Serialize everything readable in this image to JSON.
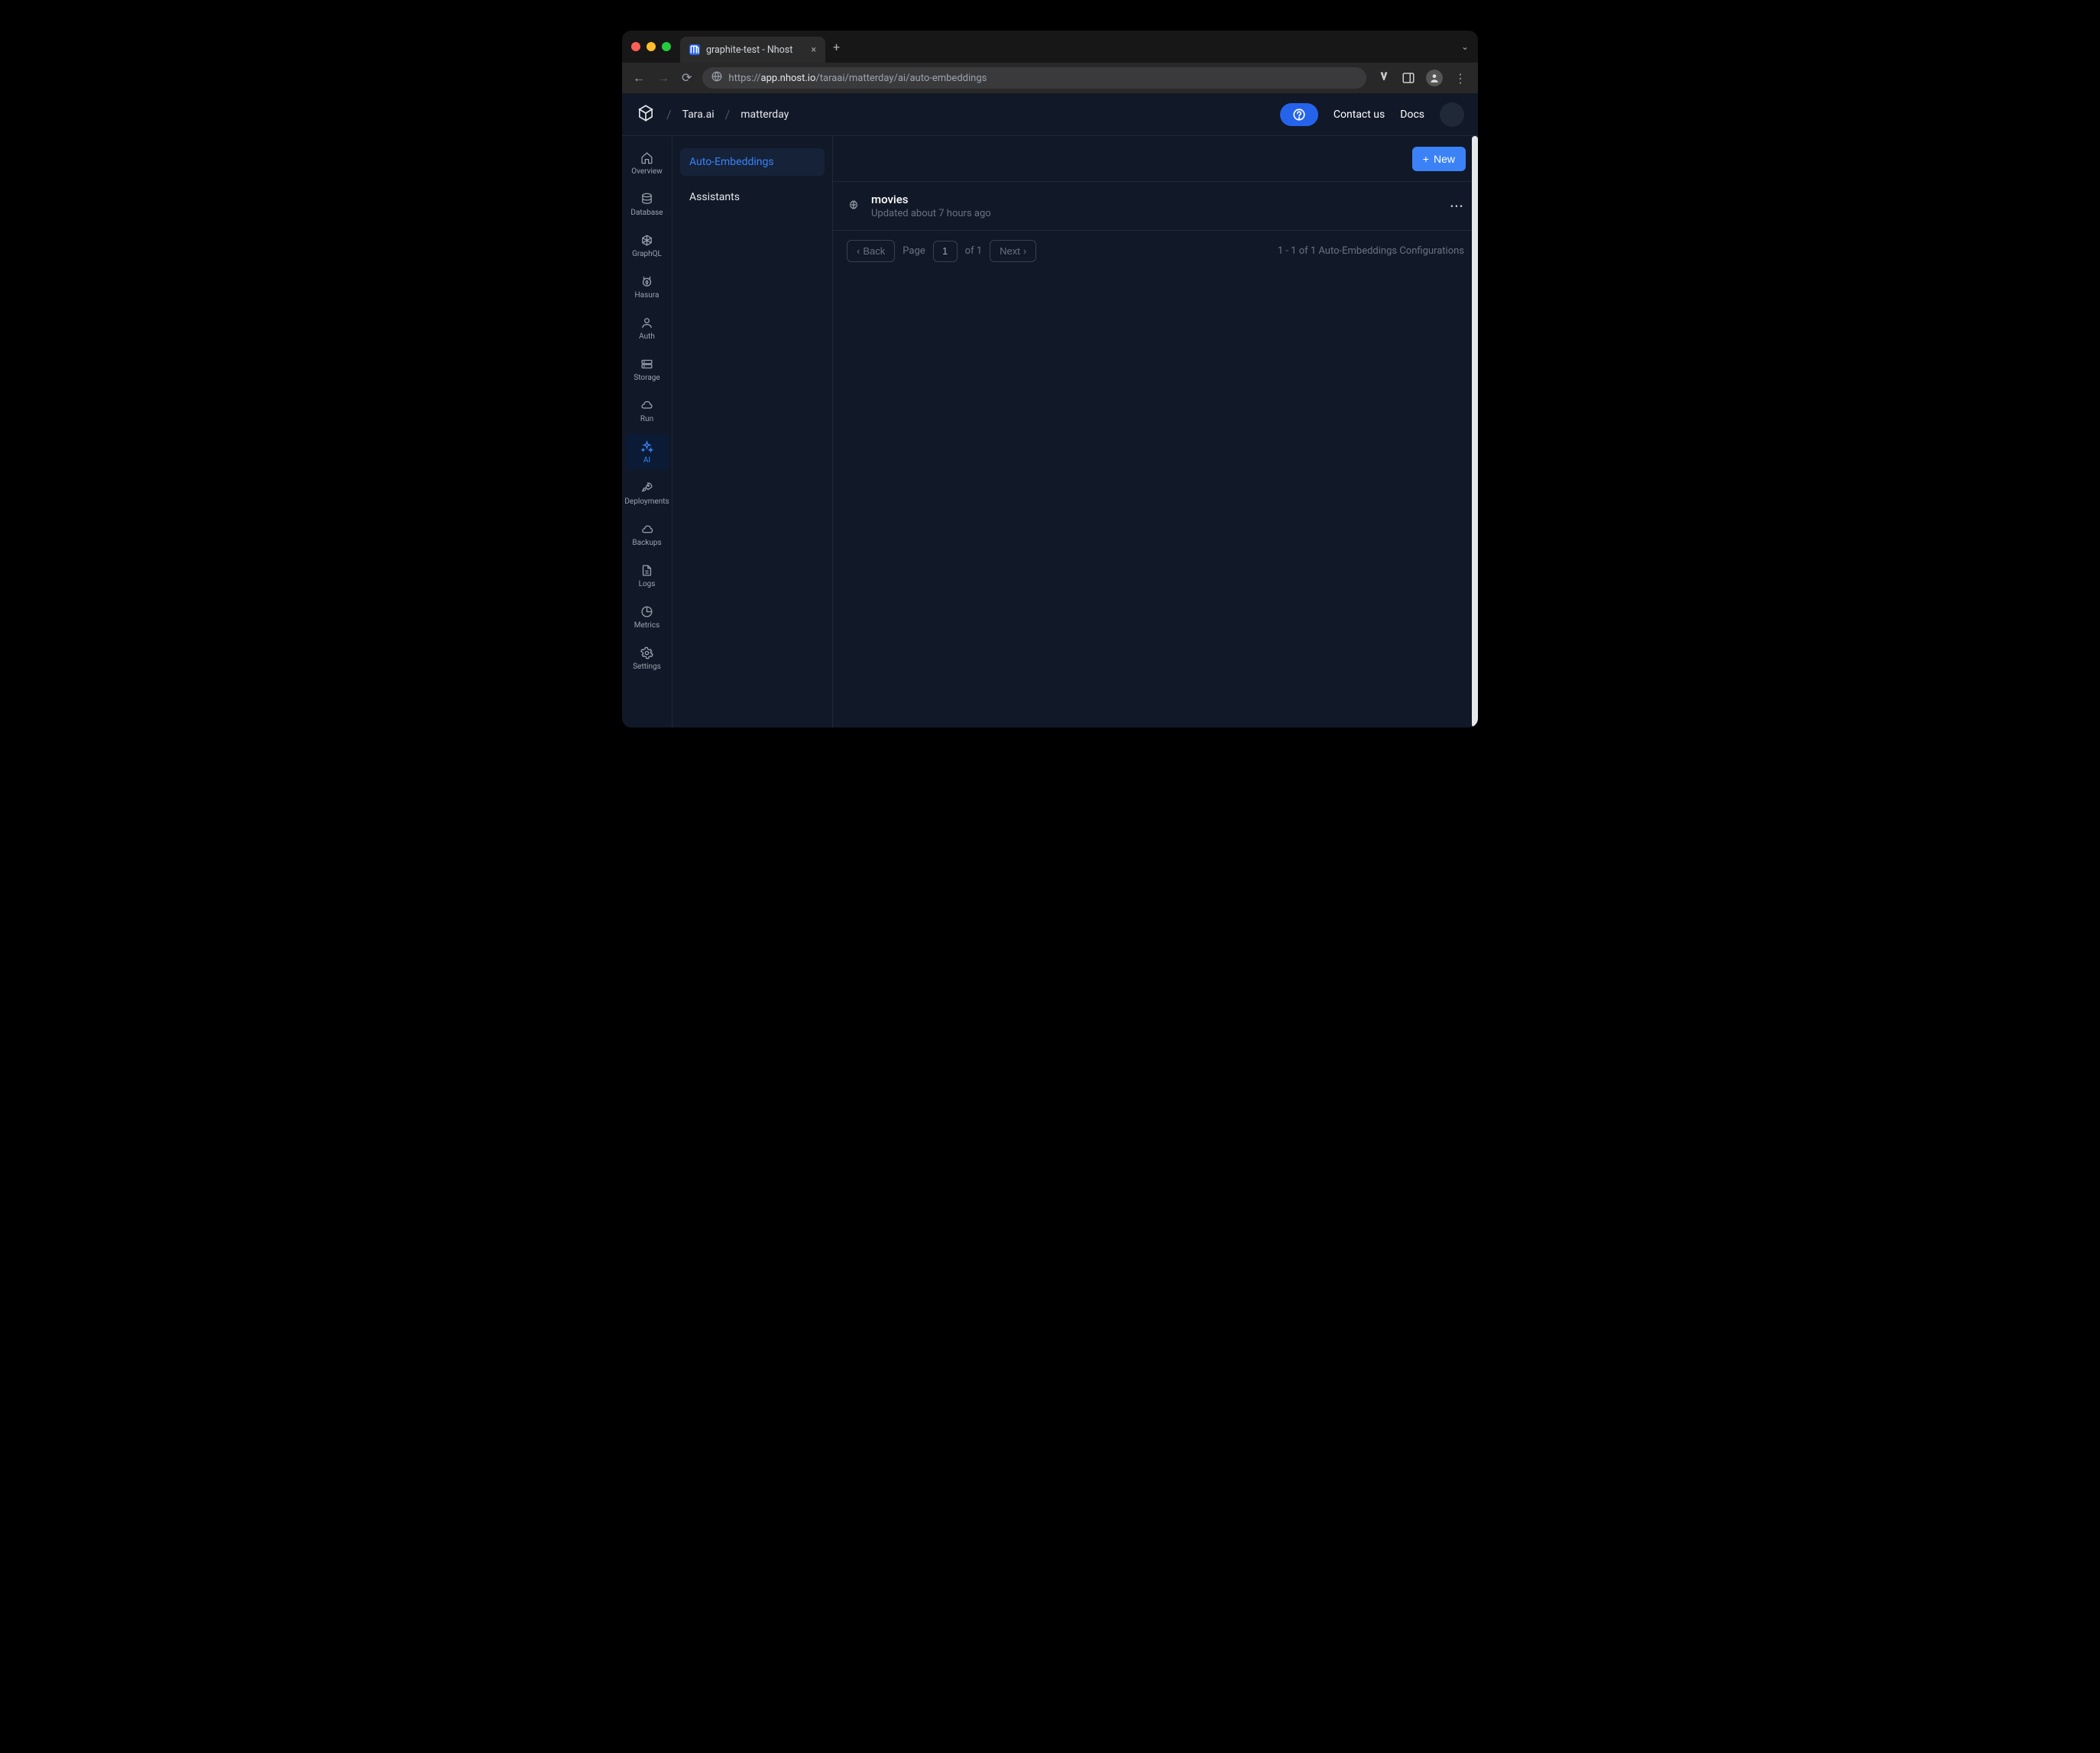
{
  "browser": {
    "tab_title": "graphite-test - Nhost",
    "url_host": "app.nhost.io",
    "url_path": "/taraai/matterday/ai/auto-embeddings",
    "url_prefix": "https://"
  },
  "header": {
    "breadcrumbs": [
      "Tara.ai",
      "matterday"
    ],
    "contact": "Contact us",
    "docs": "Docs"
  },
  "sidenav": [
    {
      "id": "overview",
      "label": "Overview"
    },
    {
      "id": "database",
      "label": "Database"
    },
    {
      "id": "graphql",
      "label": "GraphQL"
    },
    {
      "id": "hasura",
      "label": "Hasura"
    },
    {
      "id": "auth",
      "label": "Auth"
    },
    {
      "id": "storage",
      "label": "Storage"
    },
    {
      "id": "run",
      "label": "Run"
    },
    {
      "id": "ai",
      "label": "AI"
    },
    {
      "id": "deployments",
      "label": "Deployments"
    },
    {
      "id": "backups",
      "label": "Backups"
    },
    {
      "id": "logs",
      "label": "Logs"
    },
    {
      "id": "metrics",
      "label": "Metrics"
    },
    {
      "id": "settings",
      "label": "Settings"
    }
  ],
  "subnav": {
    "items": [
      "Auto-Embeddings",
      "Assistants"
    ],
    "active": "Auto-Embeddings"
  },
  "content": {
    "new_button": "New",
    "items": [
      {
        "title": "movies",
        "subtitle": "Updated about 7 hours ago"
      }
    ],
    "pagination": {
      "back": "Back",
      "page_label": "Page",
      "page_value": "1",
      "of_label": "of 1",
      "next": "Next",
      "status": "1 - 1 of 1 Auto-Embeddings Configurations"
    }
  }
}
